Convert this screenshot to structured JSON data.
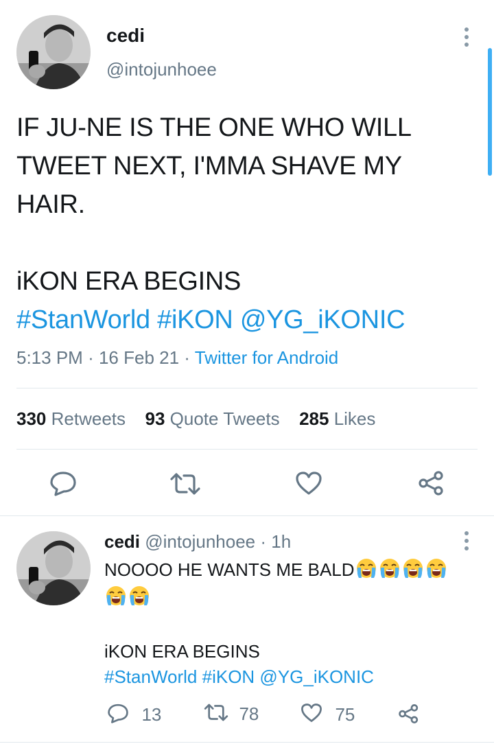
{
  "main_tweet": {
    "author_name": "cedi",
    "author_handle": "@intojunhoee",
    "text_line1": "IF JU-NE IS THE ONE WHO WILL",
    "text_line2": "TWEET NEXT, I'MMA SHAVE MY",
    "text_line3": "HAIR.",
    "text_line4": "iKON ERA BEGINS",
    "hashtag1": "#StanWorld",
    "hashtag2": "#iKON",
    "mention": "@YG_iKONIC",
    "time": "5:13 PM",
    "sep1": "·",
    "date": "16 Feb 21",
    "sep2": "·",
    "source": "Twitter for Android",
    "retweets_count": "330",
    "retweets_label": "Retweets",
    "quotes_count": "93",
    "quotes_label": "Quote Tweets",
    "likes_count": "285",
    "likes_label": "Likes"
  },
  "reply_tweet": {
    "author_name": "cedi",
    "author_handle": "@intojunhoee",
    "sep": "·",
    "age": "1h",
    "text_line1": "NOOOO HE WANTS ME BALD",
    "text_line2": "iKON ERA BEGINS",
    "hashtag1": "#StanWorld",
    "hashtag2": "#iKON",
    "mention": "@YG_iKONIC",
    "reply_count": "13",
    "retweet_count": "78",
    "like_count": "75",
    "emoji_count": 6,
    "emoji_name": "loudly-crying-face"
  },
  "icons": [
    "more-vertical-icon",
    "reply-icon",
    "retweet-icon",
    "like-icon",
    "share-icon"
  ],
  "colors": {
    "accent": "#1b95e0",
    "secondary_text": "#657786",
    "divider": "#e1e8ed"
  }
}
